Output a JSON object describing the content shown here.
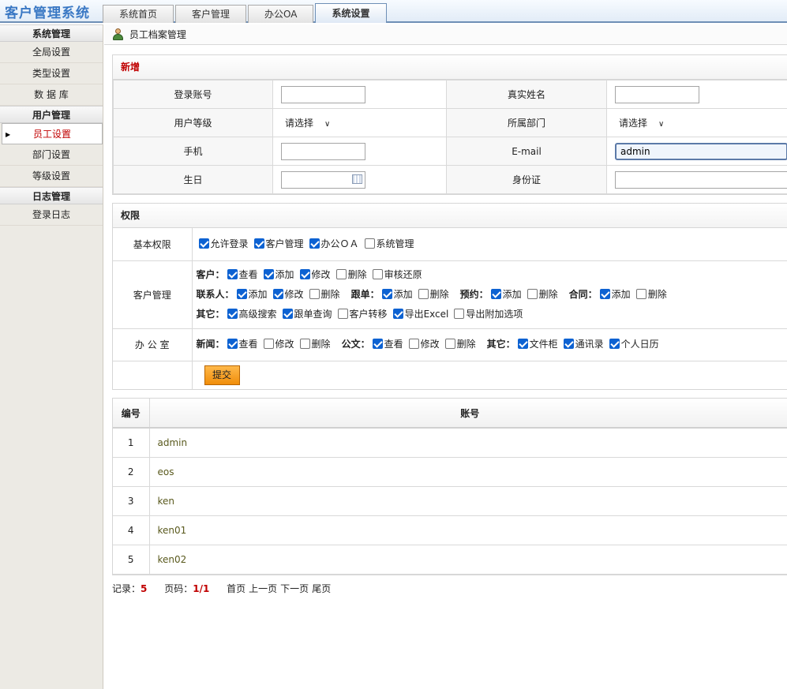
{
  "app": {
    "title": "客户管理系统"
  },
  "tabs": [
    {
      "label": "系统首页"
    },
    {
      "label": "客户管理"
    },
    {
      "label": "办公OA"
    },
    {
      "label": "系统设置"
    }
  ],
  "sidebar": {
    "groups": [
      {
        "title": "系统管理",
        "items": [
          "全局设置",
          "类型设置",
          "数 据 库"
        ]
      },
      {
        "title": "用户管理",
        "items": [
          "员工设置",
          "部门设置",
          "等级设置"
        ]
      },
      {
        "title": "日志管理",
        "items": [
          "登录日志"
        ]
      }
    ]
  },
  "page": {
    "title": "员工档案管理"
  },
  "new_form": {
    "title": "新增",
    "login_label": "登录账号",
    "login_value": "",
    "realname_label": "真实姓名",
    "realname_value": "",
    "level_label": "用户等级",
    "level_value": "请选择",
    "dept_label": "所属部门",
    "dept_value": "请选择",
    "mobile_label": "手机",
    "mobile_value": "",
    "email_label": "E-mail",
    "email_value": "admin",
    "birthday_label": "生日",
    "birthday_value": "",
    "idcard_label": "身份证",
    "idcard_value": ""
  },
  "permissions": {
    "title": "权限",
    "basic": {
      "label": "基本权限",
      "options": [
        {
          "label": "允许登录",
          "checked": true
        },
        {
          "label": "客户管理",
          "checked": true
        },
        {
          "label": "办公ＯＡ",
          "checked": true
        },
        {
          "label": "系统管理",
          "checked": false
        }
      ]
    },
    "customer": {
      "label": "客户管理",
      "lines": [
        [
          {
            "group": "客户：",
            "options": [
              {
                "label": "查看",
                "checked": true
              },
              {
                "label": "添加",
                "checked": true
              },
              {
                "label": "修改",
                "checked": true
              },
              {
                "label": "删除",
                "checked": false
              },
              {
                "label": "审核还原",
                "checked": false
              }
            ]
          }
        ],
        [
          {
            "group": "联系人：",
            "options": [
              {
                "label": "添加",
                "checked": true
              },
              {
                "label": "修改",
                "checked": true
              },
              {
                "label": "删除",
                "checked": false
              }
            ]
          },
          {
            "group": "跟单：",
            "options": [
              {
                "label": "添加",
                "checked": true
              },
              {
                "label": "删除",
                "checked": false
              }
            ]
          },
          {
            "group": "预约：",
            "options": [
              {
                "label": "添加",
                "checked": true
              },
              {
                "label": "删除",
                "checked": false
              }
            ]
          },
          {
            "group": "合同：",
            "options": [
              {
                "label": "添加",
                "checked": true
              },
              {
                "label": "删除",
                "checked": false
              }
            ]
          }
        ],
        [
          {
            "group": "其它：",
            "options": [
              {
                "label": "高级搜索",
                "checked": true
              },
              {
                "label": "跟单查询",
                "checked": true
              },
              {
                "label": "客户转移",
                "checked": false
              },
              {
                "label": "导出Excel",
                "checked": true
              },
              {
                "label": "导出附加选项",
                "checked": false
              }
            ]
          }
        ]
      ]
    },
    "office": {
      "label": "办 公 室",
      "lines": [
        [
          {
            "group": "新闻：",
            "options": [
              {
                "label": "查看",
                "checked": true
              },
              {
                "label": "修改",
                "checked": false
              },
              {
                "label": "删除",
                "checked": false
              }
            ]
          },
          {
            "group": "公文：",
            "options": [
              {
                "label": "查看",
                "checked": true
              },
              {
                "label": "修改",
                "checked": false
              },
              {
                "label": "删除",
                "checked": false
              }
            ]
          },
          {
            "group": "其它：",
            "options": [
              {
                "label": "文件柜",
                "checked": true
              },
              {
                "label": "通讯录",
                "checked": true
              },
              {
                "label": "个人日历",
                "checked": true
              }
            ]
          }
        ]
      ]
    },
    "submit_label": "提交"
  },
  "list": {
    "headers": [
      "编号",
      "账号"
    ],
    "rows": [
      {
        "no": "1",
        "account": "admin"
      },
      {
        "no": "2",
        "account": "eos"
      },
      {
        "no": "3",
        "account": "ken"
      },
      {
        "no": "4",
        "account": "ken01"
      },
      {
        "no": "5",
        "account": "ken02"
      }
    ]
  },
  "pager": {
    "records_label": "记录：",
    "records": "5",
    "page_label": "页码：",
    "page": "1/1",
    "links": [
      "首页",
      "上一页",
      "下一页",
      "尾页"
    ]
  },
  "colors": {
    "accent": "#3a78c4",
    "active_red": "#c00000",
    "button_orange": "#f5a623"
  }
}
